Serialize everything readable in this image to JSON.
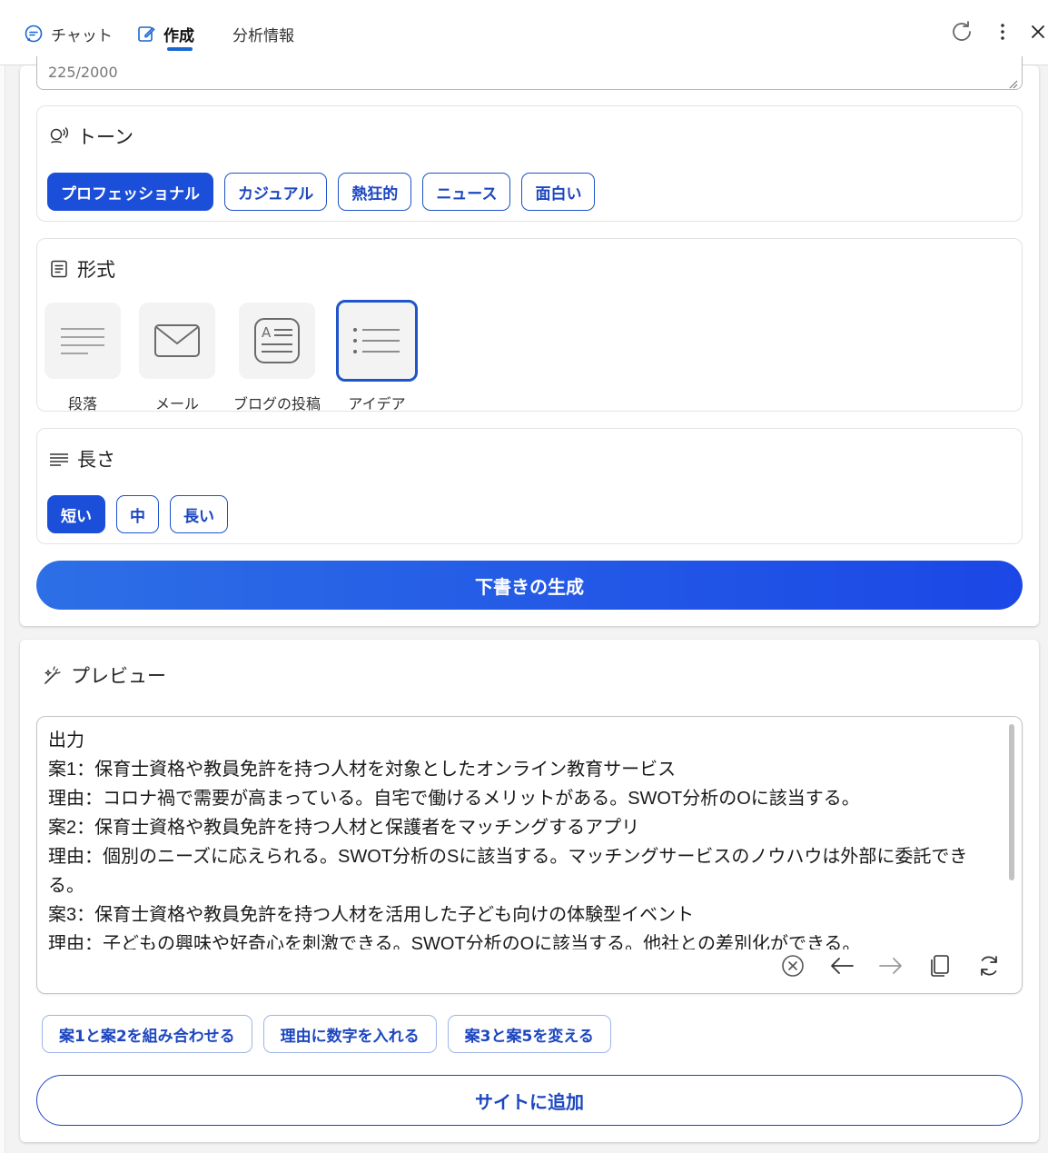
{
  "tabs": {
    "chat": "チャット",
    "compose": "作成",
    "insights": "分析情報"
  },
  "input": {
    "char_count": "225/2000"
  },
  "tone": {
    "title": "トーン",
    "options": [
      "プロフェッショナル",
      "カジュアル",
      "熱狂的",
      "ニュース",
      "面白い"
    ],
    "selected": "プロフェッショナル"
  },
  "format": {
    "title": "形式",
    "options": [
      "段落",
      "メール",
      "ブログの投稿",
      "アイデア"
    ],
    "selected": "アイデア"
  },
  "length": {
    "title": "長さ",
    "options": [
      "短い",
      "中",
      "長い"
    ],
    "selected": "短い"
  },
  "generate_label": "下書きの生成",
  "preview": {
    "title": "プレビュー",
    "output": "出力\n案1：保育士資格や教員免許を持つ人材を対象としたオンライン教育サービス\n理由：コロナ禍で需要が高まっている。自宅で働けるメリットがある。SWOT分析のOに該当する。\n案2：保育士資格や教員免許を持つ人材と保護者をマッチングするアプリ\n理由：個別のニーズに応えられる。SWOT分析のSに該当する。マッチングサービスのノウハウは外部に委託できる。\n案3：保育士資格や教員免許を持つ人材を活用した子ども向けの体験型イベント\n理由：子どもの興味や好奇心を刺激できる。SWOT分析のOに該当する。他社との差別化ができる。"
  },
  "suggestions": [
    "案1と案2を組み合わせる",
    "理由に数字を入れる",
    "案3と案5を変える"
  ],
  "add_label": "サイトに追加",
  "colors": {
    "accent": "#1c4fd9",
    "gradient_start": "#2d6fe6",
    "gradient_end": "#1b47e6"
  }
}
